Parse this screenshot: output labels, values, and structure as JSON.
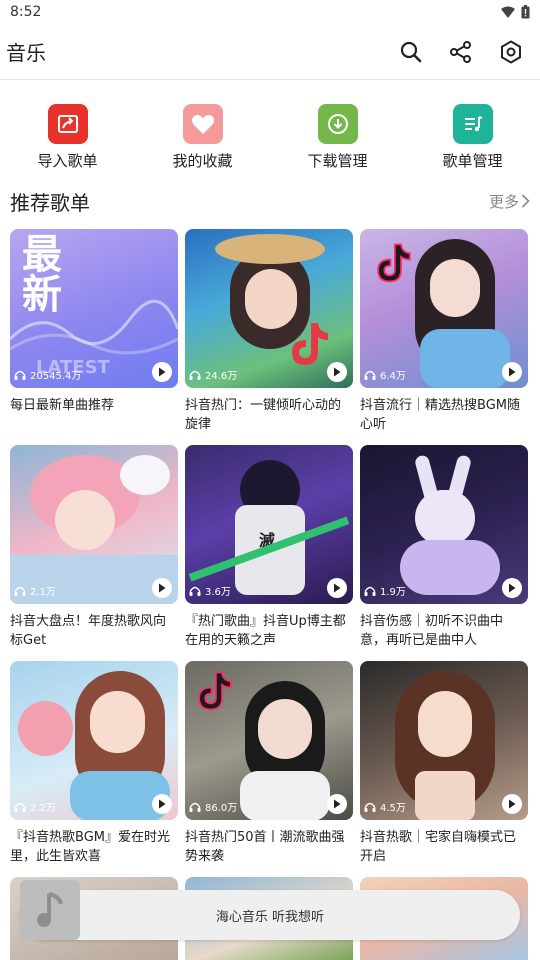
{
  "status": {
    "time": "8:52"
  },
  "appbar": {
    "title": "音乐"
  },
  "quick": [
    {
      "label": "导入歌单",
      "color": "#e8332d",
      "icon": "import-icon"
    },
    {
      "label": "我的收藏",
      "color": "#f49a9a",
      "icon": "heart-icon"
    },
    {
      "label": "下载管理",
      "color": "#74b84b",
      "icon": "download-icon"
    },
    {
      "label": "歌单管理",
      "color": "#1fb49a",
      "icon": "playlist-icon"
    }
  ],
  "section": {
    "title": "推荐歌单",
    "more": "更多"
  },
  "playlists": [
    {
      "title": "每日最新单曲推荐",
      "plays": "20545.4万"
    },
    {
      "title": "抖音热门：一键倾听心动的旋律",
      "plays": "24.6万"
    },
    {
      "title": "抖音流行｜精选热搜BGM随心听",
      "plays": "6.4万"
    },
    {
      "title": "抖音大盘点！年度热歌风向标Get",
      "plays": "2.1万"
    },
    {
      "title": "『热门歌曲』抖音Up博主都在用的天籁之声",
      "plays": "3.6万"
    },
    {
      "title": "抖音伤感｜初听不识曲中意，再听已是曲中人",
      "plays": "1.9万"
    },
    {
      "title": "『抖音热歌BGM』爱在时光里，此生皆欢喜",
      "plays": "2.2万"
    },
    {
      "title": "抖音热门50首丨潮流歌曲强势来袭",
      "plays": "86.0万"
    },
    {
      "title": "抖音热歌｜宅家自嗨模式已开启",
      "plays": "4.5万"
    }
  ],
  "cover1": {
    "big1": "最",
    "big2": "新",
    "sub": "LATEST"
  },
  "player": {
    "text": "海心音乐 听我想听"
  }
}
